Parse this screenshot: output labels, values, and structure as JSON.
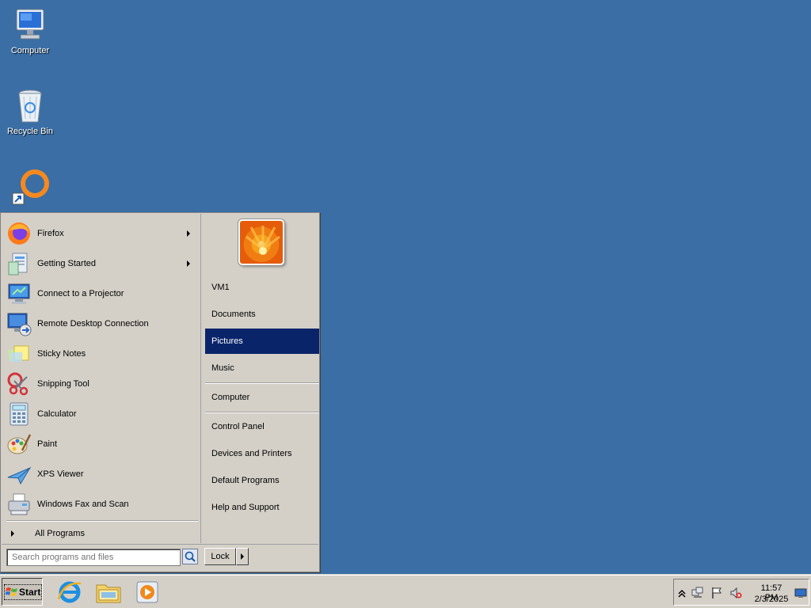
{
  "desktop": {
    "background_color": "#3a6ea5",
    "icons": [
      {
        "label": "Computer",
        "icon": "computer-icon"
      },
      {
        "label": "Recycle Bin",
        "icon": "recycle-bin-icon"
      },
      {
        "label": "",
        "icon": "vlc-shortcut-icon"
      }
    ]
  },
  "start_menu": {
    "programs": [
      {
        "label": "Firefox",
        "icon": "firefox-icon",
        "has_submenu": true
      },
      {
        "label": "Getting Started",
        "icon": "getting-started-icon",
        "has_submenu": true
      },
      {
        "label": "Connect to a Projector",
        "icon": "projector-icon",
        "has_submenu": false
      },
      {
        "label": "Remote Desktop Connection",
        "icon": "remote-desktop-icon",
        "has_submenu": false
      },
      {
        "label": "Sticky Notes",
        "icon": "sticky-notes-icon",
        "has_submenu": false
      },
      {
        "label": "Snipping Tool",
        "icon": "snipping-tool-icon",
        "has_submenu": false
      },
      {
        "label": "Calculator",
        "icon": "calculator-icon",
        "has_submenu": false
      },
      {
        "label": "Paint",
        "icon": "paint-icon",
        "has_submenu": false
      },
      {
        "label": "XPS Viewer",
        "icon": "xps-viewer-icon",
        "has_submenu": false
      },
      {
        "label": "Windows Fax and Scan",
        "icon": "fax-scan-icon",
        "has_submenu": false
      }
    ],
    "all_programs": "All Programs",
    "places": [
      {
        "label": "VM1"
      },
      {
        "label": "Documents"
      },
      {
        "label": "Pictures",
        "selected": true
      },
      {
        "label": "Music"
      },
      {
        "label": "Computer"
      },
      {
        "label": "Control Panel"
      },
      {
        "label": "Devices and Printers"
      },
      {
        "label": "Default Programs"
      },
      {
        "label": "Help and Support"
      }
    ],
    "search_placeholder": "Search programs and files",
    "lock_label": "Lock",
    "selection_color": "#0a246a"
  },
  "taskbar": {
    "start_label": "Start",
    "pinned": [
      "internet-explorer-icon",
      "windows-explorer-icon",
      "media-player-icon"
    ],
    "clock": {
      "time": "11:57 PM",
      "date": "2/3/2025"
    },
    "tray_icons": [
      "show-hidden-icons-chevron",
      "network-icon",
      "action-center-flag-icon",
      "volume-muted-icon",
      "show-desktop-icon"
    ]
  }
}
